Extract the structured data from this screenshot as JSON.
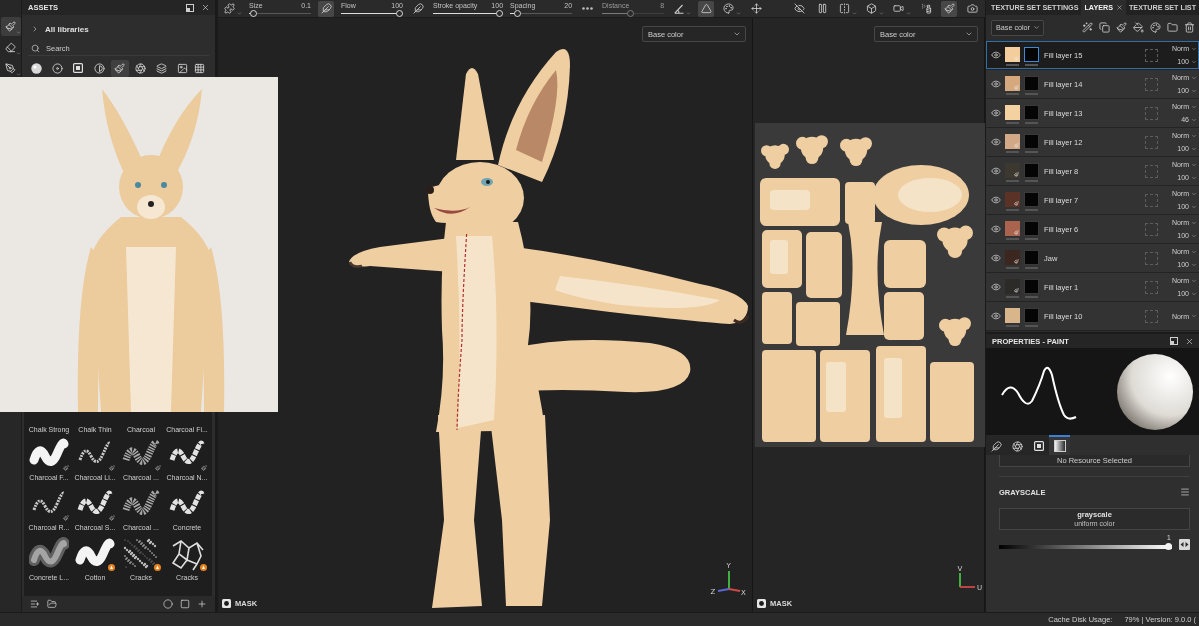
{
  "left_tools": [
    {
      "kind": "brush",
      "selected": true
    },
    {
      "kind": "eraser",
      "selected": false
    },
    {
      "kind": "projection",
      "selected": false
    }
  ],
  "assets": {
    "title": "ASSETS",
    "library": "All libraries",
    "search": {
      "placeholder": "Search"
    },
    "filters": [
      {
        "kind": "material",
        "selected": false
      },
      {
        "kind": "smart-material",
        "selected": false
      },
      {
        "kind": "mask",
        "selected": false
      },
      {
        "kind": "filter",
        "selected": false
      },
      {
        "kind": "brush",
        "selected": true
      },
      {
        "kind": "alpha",
        "selected": false
      },
      {
        "kind": "texture",
        "selected": false
      },
      {
        "kind": "environment",
        "selected": false
      }
    ],
    "covered_labels": [
      "Chalk Strong",
      "Chalk Thin",
      "Charcoal",
      "Charcoal Fi..."
    ],
    "brushes": [
      {
        "label": "Charcoal F...",
        "kind": "solid",
        "badge": {
          "kind": "tool"
        }
      },
      {
        "label": "Charcoal Li...",
        "kind": "thin",
        "badge": {
          "kind": "tool"
        }
      },
      {
        "label": "Charcoal ...",
        "kind": "grainy",
        "badge": {
          "kind": "tool"
        }
      },
      {
        "label": "Charcoal N...",
        "kind": "rough",
        "badge": {
          "kind": "tool"
        }
      },
      {
        "label": "Charcoal R...",
        "kind": "thin",
        "badge": {
          "kind": "tool"
        }
      },
      {
        "label": "Charcoal S...",
        "kind": "rough",
        "badge": {
          "kind": "tool"
        }
      },
      {
        "label": "Charcoal ...",
        "kind": "grainy"
      },
      {
        "label": "Concrete",
        "kind": "rough"
      },
      {
        "label": "Concrete L...",
        "kind": "soft"
      },
      {
        "label": "Cotton",
        "kind": "solid",
        "badge": {
          "kind": "flame"
        }
      },
      {
        "label": "Cracks",
        "kind": "speckle",
        "badge": {
          "kind": "flame"
        }
      },
      {
        "label": "Cracks",
        "kind": "cracks",
        "badge": {
          "kind": "flame"
        }
      }
    ]
  },
  "toolbar": {
    "items": [
      {
        "kind": "stencil",
        "selected": false,
        "caret": true
      },
      {
        "kind": "slider",
        "label": "Size",
        "value": "0.1",
        "level": 0.02,
        "disabled": false
      },
      {
        "kind": "pressure",
        "selected": true
      },
      {
        "kind": "slider",
        "label": "Flow",
        "value": "100",
        "level": 1,
        "disabled": false
      },
      {
        "kind": "pressure",
        "selected": false
      },
      {
        "kind": "slider",
        "label": "Stroke opacity",
        "value": "100",
        "level": 1,
        "disabled": false
      },
      {
        "kind": "slider",
        "label": "Spacing",
        "value": "20",
        "level": 0.08,
        "disabled": false
      },
      {
        "kind": "lazy-mouse",
        "selected": false
      },
      {
        "kind": "slider",
        "label": "Distance",
        "value": "8",
        "level": 0.45,
        "disabled": true
      },
      {
        "kind": "angle",
        "selected": false,
        "caret": true
      },
      {
        "kind": "symmetry",
        "selected": true
      },
      {
        "kind": "paint-mode",
        "selected": false,
        "caret": true
      },
      {
        "kind": "transform",
        "selected": false
      },
      {
        "kind": "hide",
        "selected": false
      },
      {
        "kind": "pause",
        "selected": false
      },
      {
        "kind": "mirror",
        "selected": false,
        "caret": true
      },
      {
        "kind": "cube",
        "selected": false,
        "caret": true
      },
      {
        "kind": "camera-view",
        "selected": false,
        "caret": true
      },
      {
        "kind": "splat",
        "selected": false
      },
      {
        "kind": "paint",
        "selected": true
      },
      {
        "kind": "screenshot",
        "selected": false
      }
    ]
  },
  "viewports": [
    {
      "kind": "model",
      "channel": "Base color",
      "mask_label": "MASK",
      "axes": [
        "Y",
        "Z",
        "X"
      ]
    },
    {
      "kind": "uv",
      "channel": "Base color",
      "mask_label": "MASK",
      "axes": [
        "V",
        "U"
      ]
    }
  ],
  "layers_panel": {
    "tabs": [
      {
        "label": "TEXTURE SET SETTINGS",
        "selected": false,
        "closable": false
      },
      {
        "label": "LAYERS",
        "selected": true,
        "closable": true
      },
      {
        "label": "TEXTURE SET LIST",
        "selected": false,
        "closable": false
      }
    ],
    "channel": "Base color",
    "layers": [
      {
        "name": "Fill layer 15",
        "color": "#f3cd9c",
        "visible": true,
        "selected": true,
        "badge": true,
        "blend": "Norm",
        "opacity": "100"
      },
      {
        "name": "Fill layer 14",
        "color": "#d6a87e",
        "visible": true,
        "selected": false,
        "badge": true,
        "blend": "Norm",
        "opacity": "100"
      },
      {
        "name": "Fill layer 13",
        "color": "#f4d1a0",
        "visible": true,
        "selected": false,
        "badge": false,
        "blend": "Norm",
        "opacity": "46"
      },
      {
        "name": "Fill layer 12",
        "color": "#d3a886",
        "visible": true,
        "selected": false,
        "badge": true,
        "blend": "Norm",
        "opacity": "100"
      },
      {
        "name": "Fill layer 8",
        "color": "#3d382f",
        "visible": true,
        "selected": false,
        "badge": true,
        "blend": "Norm",
        "opacity": "100"
      },
      {
        "name": "Fill layer 7",
        "color": "#5b3226",
        "visible": true,
        "selected": false,
        "badge": true,
        "blend": "Norm",
        "opacity": "100"
      },
      {
        "name": "Fill layer 6",
        "color": "#a9634f",
        "visible": true,
        "selected": false,
        "badge": true,
        "blend": "Norm",
        "opacity": "100"
      },
      {
        "name": "Jaw",
        "color": "#3b2620",
        "visible": true,
        "selected": false,
        "badge": true,
        "blend": "Norm",
        "opacity": "100"
      },
      {
        "name": "Fill layer 1",
        "color": "#2c2b27",
        "visible": true,
        "selected": false,
        "badge": true,
        "blend": "Norm",
        "opacity": "100"
      },
      {
        "name": "Fill layer 10",
        "color": "#d9b58b",
        "visible": true,
        "selected": false,
        "badge": false,
        "blend": "Norm"
      }
    ]
  },
  "properties": {
    "title": "PROPERTIES - PAINT",
    "tabs": [
      {
        "kind": "brush",
        "selected": false
      },
      {
        "kind": "alpha",
        "selected": false
      },
      {
        "kind": "stencil",
        "selected": false
      },
      {
        "kind": "material",
        "selected": true
      }
    ],
    "resource": "No Resource Selected",
    "section": "GRAYSCALE",
    "value_name": "grayscale",
    "value_type": "uniform color",
    "slider": {
      "value": "1",
      "level": 1
    }
  },
  "status_bar": {
    "label": "Cache Disk Usage:",
    "value": "79% | Version: 9.0.0 ("
  }
}
